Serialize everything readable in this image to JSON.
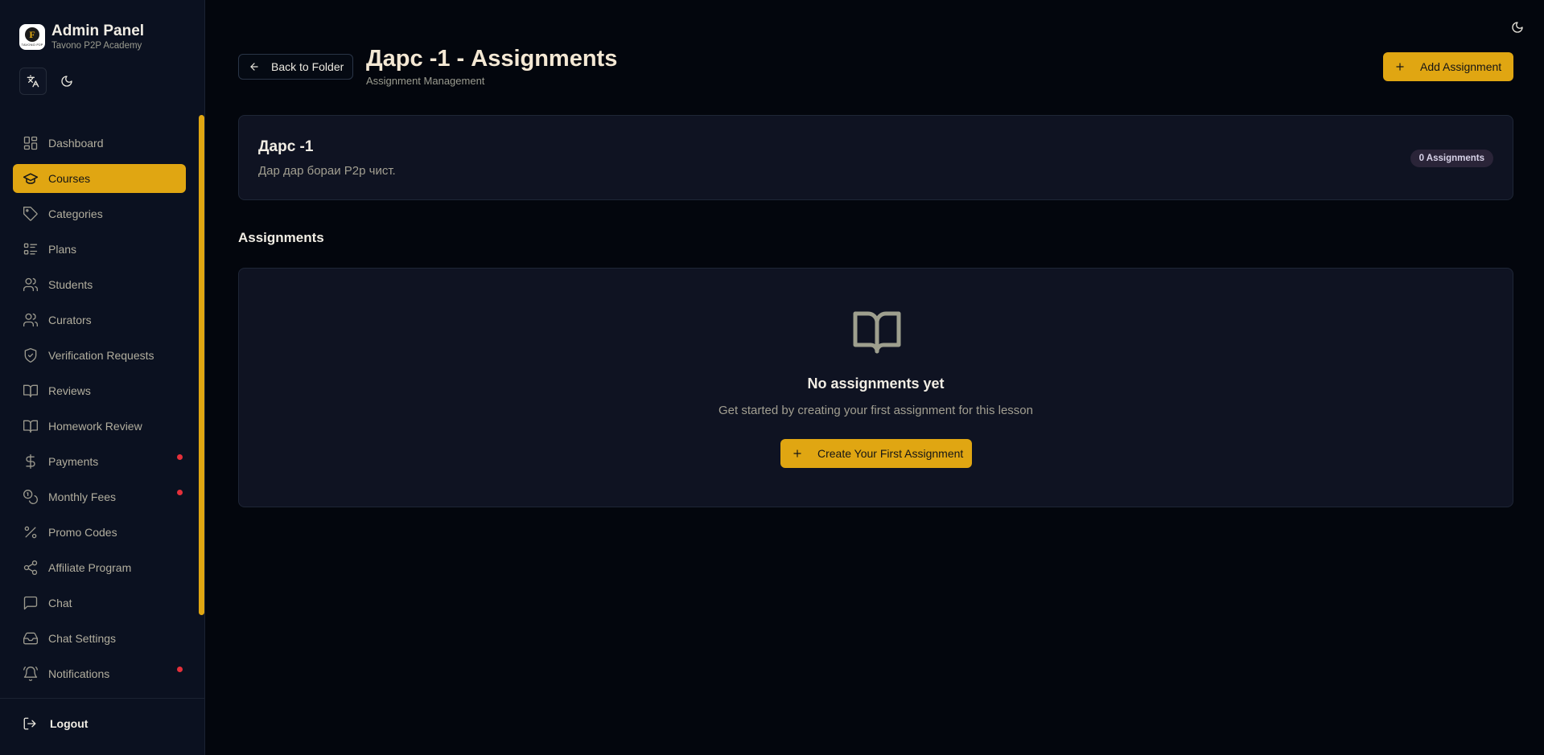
{
  "sidebar": {
    "brand": {
      "title": "Admin Panel",
      "subtitle": "Tavono P2P Academy",
      "logo_letter": "F",
      "logo_text": "TAVONO P2P"
    },
    "controls": [
      "translate-icon",
      "moon-icon"
    ],
    "items": [
      {
        "label": "Dashboard",
        "icon": "dashboard-icon",
        "active": false,
        "badge": false
      },
      {
        "label": "Courses",
        "icon": "graduation-cap-icon",
        "active": true,
        "badge": false
      },
      {
        "label": "Categories",
        "icon": "tag-icon",
        "active": false,
        "badge": false
      },
      {
        "label": "Plans",
        "icon": "list-icon",
        "active": false,
        "badge": false
      },
      {
        "label": "Students",
        "icon": "users-icon",
        "active": false,
        "badge": false
      },
      {
        "label": "Curators",
        "icon": "users-icon",
        "active": false,
        "badge": false
      },
      {
        "label": "Verification Requests",
        "icon": "shield-check-icon",
        "active": false,
        "badge": false
      },
      {
        "label": "Reviews",
        "icon": "book-icon",
        "active": false,
        "badge": false
      },
      {
        "label": "Homework Review",
        "icon": "book-icon",
        "active": false,
        "badge": false
      },
      {
        "label": "Payments",
        "icon": "dollar-icon",
        "active": false,
        "badge": true
      },
      {
        "label": "Monthly Fees",
        "icon": "coins-icon",
        "active": false,
        "badge": true
      },
      {
        "label": "Promo Codes",
        "icon": "percent-icon",
        "active": false,
        "badge": false
      },
      {
        "label": "Affiliate Program",
        "icon": "share-icon",
        "active": false,
        "badge": false
      },
      {
        "label": "Chat",
        "icon": "message-square-icon",
        "active": false,
        "badge": false
      },
      {
        "label": "Chat Settings",
        "icon": "inbox-icon",
        "active": false,
        "badge": false
      },
      {
        "label": "Notifications",
        "icon": "bell-icon",
        "active": false,
        "badge": true
      }
    ],
    "logout_label": "Logout"
  },
  "header": {
    "back_label": "Back to Folder",
    "title": "Дарс -1 - Assignments",
    "subtitle": "Assignment Management",
    "add_label": "Add Assignment"
  },
  "lesson": {
    "title": "Дарс -1",
    "description": "Дар дар бораи P2p чист.",
    "count_badge": "0 Assignments"
  },
  "assignments": {
    "section_title": "Assignments",
    "empty_title": "No assignments yet",
    "empty_description": "Get started by creating your first assignment for this lesson",
    "create_label": "Create Your First Assignment"
  },
  "colors": {
    "accent": "#e0a612",
    "background": "#03060d",
    "sidebar": "#0b1120",
    "card": "#0f1322",
    "badge_dot": "#e5303a"
  }
}
